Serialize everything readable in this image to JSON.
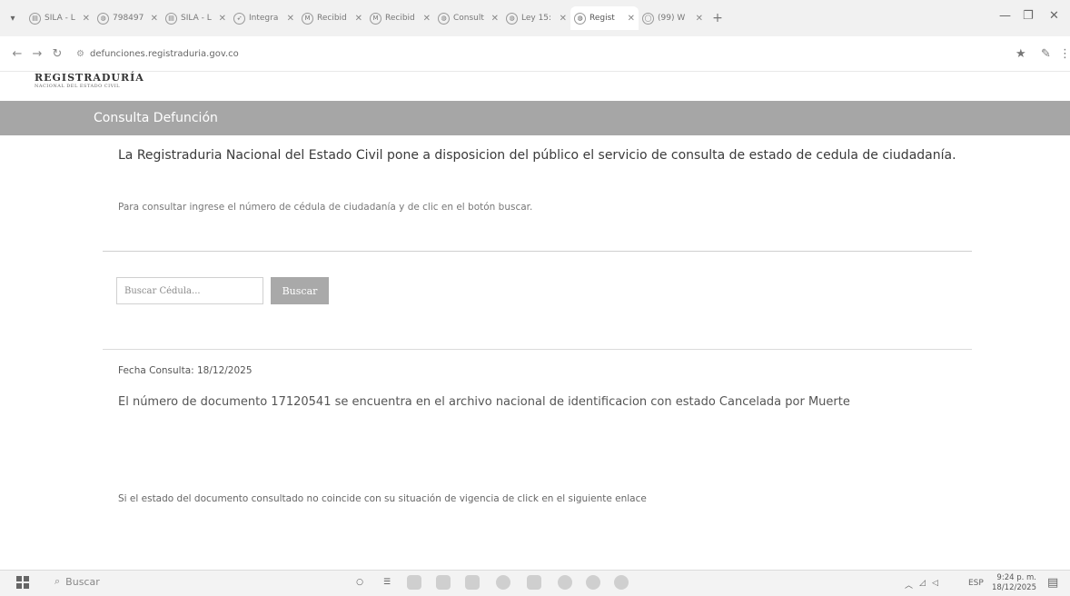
{
  "browser": {
    "tabs": [
      {
        "label": "SILA - L",
        "icon": "doc-icon",
        "active": false
      },
      {
        "label": "798497",
        "icon": "globe-icon",
        "active": false
      },
      {
        "label": "SILA - L",
        "icon": "doc-icon",
        "active": false
      },
      {
        "label": "Integra",
        "icon": "arrow-icon",
        "active": false
      },
      {
        "label": "Recibid",
        "icon": "mail-icon",
        "active": false
      },
      {
        "label": "Recibid",
        "icon": "mail-icon",
        "active": false
      },
      {
        "label": "Consult",
        "icon": "globe-icon",
        "active": false
      },
      {
        "label": "Ley 15:",
        "icon": "globe-icon",
        "active": false
      },
      {
        "label": "Regist",
        "icon": "globe-icon",
        "active": true
      },
      {
        "label": "(99) W",
        "icon": "whatsapp-icon",
        "active": false
      }
    ],
    "url": "defunciones.registraduria.gov.co"
  },
  "site": {
    "logo_main": "REGISTRADURÍA",
    "logo_sub": "NACIONAL DEL ESTADO CIVIL",
    "banner_title": "Consulta Defunción",
    "intro": "La Registraduria Nacional del Estado Civil pone a disposicion del público el servicio de consulta de estado de cedula de ciudadanía.",
    "instructions": "Para consultar ingrese el número de cédula de ciudadanía y de clic en el botón buscar.",
    "search": {
      "placeholder": "Buscar Cédula...",
      "button_label": "Buscar"
    },
    "fecha_consulta": "Fecha Consulta: 18/12/2025",
    "resultado": "El número de documento 17120541 se encuentra en el archivo nacional de identificacion con estado Cancelada por Muerte",
    "footer_note": "Si el estado del documento consultado no coincide con su situación de vigencia de click en el siguiente enlace"
  },
  "taskbar": {
    "search_placeholder": "Buscar",
    "language": "ESP",
    "time": "9:24 p. m.",
    "date": "18/12/2025"
  }
}
